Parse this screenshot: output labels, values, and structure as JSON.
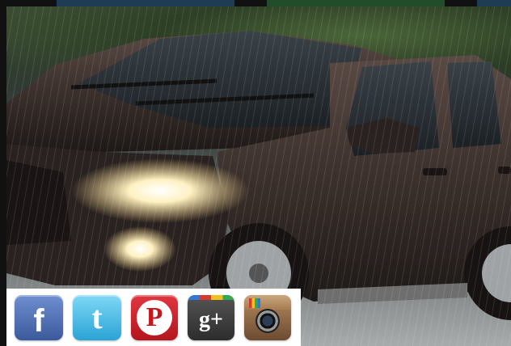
{
  "colors": {
    "topbar_segments": [
      "#111111",
      "#1f3c55",
      "#111111",
      "#214d2b",
      "#111111",
      "#1f3c55"
    ],
    "facebook": "#3b5a9b",
    "twitter": "#2aa3d6",
    "pinterest": "#c8161e",
    "googleplus": "#2d2d2d",
    "instagram": "#6d4b31"
  },
  "photo": {
    "subject": "car-in-rain-photo"
  },
  "social": {
    "facebook": {
      "icon": "facebook-icon",
      "glyph": "f"
    },
    "twitter": {
      "icon": "twitter-icon",
      "glyph": "t"
    },
    "pinterest": {
      "icon": "pinterest-icon",
      "glyph": "P"
    },
    "googleplus": {
      "icon": "google-plus-icon",
      "glyph": "g+"
    },
    "instagram": {
      "icon": "instagram-icon"
    }
  }
}
